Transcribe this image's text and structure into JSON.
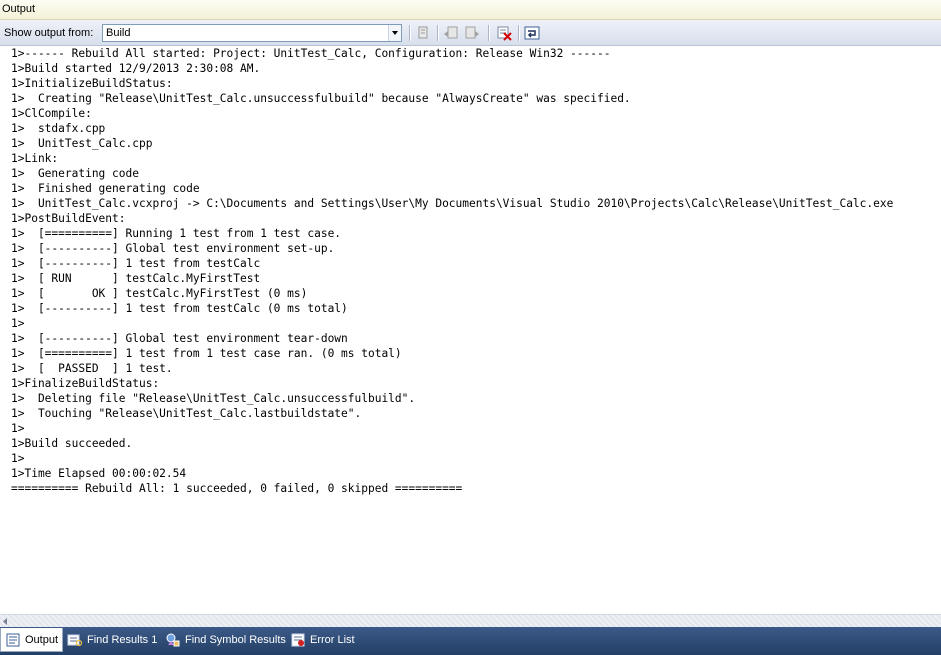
{
  "window": {
    "title": "Output"
  },
  "toolbar": {
    "show_output_label": "Show output from:",
    "source_value": "Build",
    "buttons": [
      "find-message-in-code-icon",
      "previous-message-icon",
      "next-message-icon",
      "clear-all-icon",
      "toggle-word-wrap-icon"
    ]
  },
  "output": {
    "lines": [
      "1>------ Rebuild All started: Project: UnitTest_Calc, Configuration: Release Win32 ------",
      "1>Build started 12/9/2013 2:30:08 AM.",
      "1>InitializeBuildStatus:",
      "1>  Creating \"Release\\UnitTest_Calc.unsuccessfulbuild\" because \"AlwaysCreate\" was specified.",
      "1>ClCompile:",
      "1>  stdafx.cpp",
      "1>  UnitTest_Calc.cpp",
      "1>Link:",
      "1>  Generating code",
      "1>  Finished generating code",
      "1>  UnitTest_Calc.vcxproj -> C:\\Documents and Settings\\User\\My Documents\\Visual Studio 2010\\Projects\\Calc\\Release\\UnitTest_Calc.exe",
      "1>PostBuildEvent:",
      "1>  [==========] Running 1 test from 1 test case.",
      "1>  [----------] Global test environment set-up.",
      "1>  [----------] 1 test from testCalc",
      "1>  [ RUN      ] testCalc.MyFirstTest",
      "1>  [       OK ] testCalc.MyFirstTest (0 ms)",
      "1>  [----------] 1 test from testCalc (0 ms total)",
      "1>",
      "1>  [----------] Global test environment tear-down",
      "1>  [==========] 1 test from 1 test case ran. (0 ms total)",
      "1>  [  PASSED  ] 1 test.",
      "1>FinalizeBuildStatus:",
      "1>  Deleting file \"Release\\UnitTest_Calc.unsuccessfulbuild\".",
      "1>  Touching \"Release\\UnitTest_Calc.lastbuildstate\".",
      "1>",
      "1>Build succeeded.",
      "1>",
      "1>Time Elapsed 00:00:02.54",
      "========== Rebuild All: 1 succeeded, 0 failed, 0 skipped =========="
    ]
  },
  "tabs": [
    {
      "label": "Output",
      "icon": "output-icon",
      "active": true
    },
    {
      "label": "Find Results 1",
      "icon": "find-results-icon",
      "active": false
    },
    {
      "label": "Find Symbol Results",
      "icon": "find-symbol-icon",
      "active": false
    },
    {
      "label": "Error List",
      "icon": "error-list-icon",
      "active": false
    }
  ]
}
